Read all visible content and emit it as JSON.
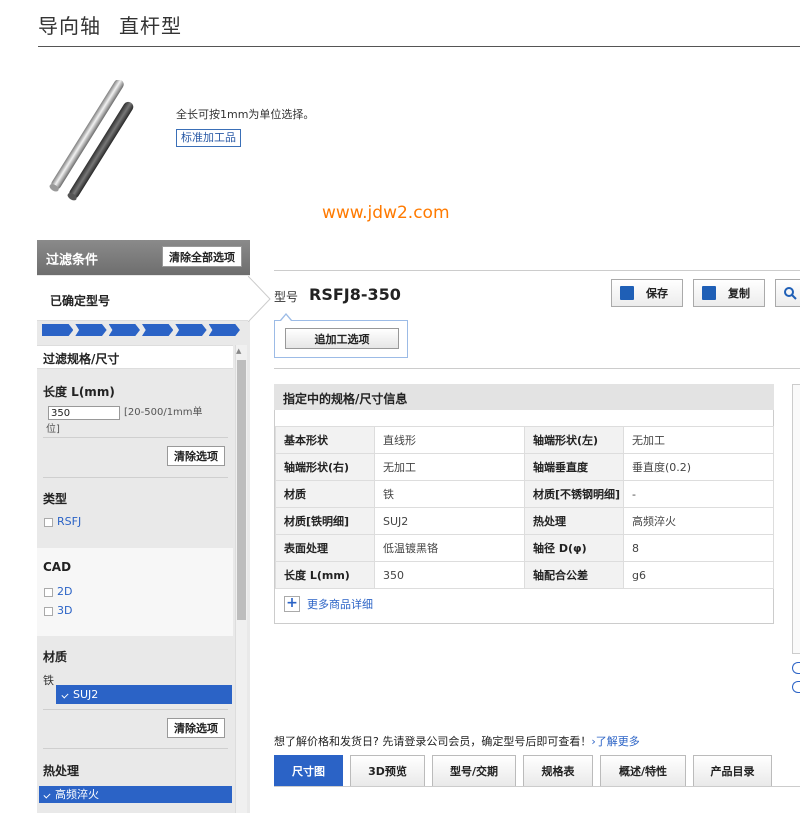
{
  "header": {
    "title_part1": "导向轴",
    "title_part2": "直杆型"
  },
  "product": {
    "description": "全长可按1mm为单位选择。",
    "tag": "标准加工品",
    "watermark": "www.jdw2.com"
  },
  "sidebar": {
    "filter_title": "过滤条件",
    "clear_all_label": "清除全部选项",
    "confirmed_label": "已确定型号",
    "step_count": 6,
    "spec_section_label": "过滤规格/尺寸",
    "length": {
      "title": "长度 L(mm)",
      "value": "350",
      "range_line1": "[20-500/1mm单",
      "range_line2": "位]",
      "clear_label": "清除选项"
    },
    "type": {
      "title": "类型",
      "options": [
        {
          "label": "RSFJ",
          "checked": false
        }
      ]
    },
    "cad": {
      "title": "CAD",
      "options": [
        {
          "label": "2D",
          "checked": false
        },
        {
          "label": "3D",
          "checked": false
        }
      ]
    },
    "material": {
      "title": "材质",
      "group": "铁",
      "options": [
        {
          "label": "SUJ2",
          "checked": true
        }
      ],
      "clear_label": "清除选项"
    },
    "heat": {
      "title": "热处理",
      "options": [
        {
          "label": "高频淬火",
          "checked": true
        }
      ]
    }
  },
  "main": {
    "model_label": "型号",
    "model_value": "RSFJ8-350",
    "actions": {
      "save_label": "保存",
      "copy_label": "复制"
    },
    "add_option_label": "追加工选项",
    "spec_title": "指定中的规格/尺寸信息",
    "specs": [
      [
        "基本形状",
        "直线形",
        "轴端形状(左)",
        "无加工"
      ],
      [
        "轴端形状(右)",
        "无加工",
        "轴端垂直度",
        "垂直度(0.2)"
      ],
      [
        "材质",
        "铁",
        "材质[不锈钢明细]",
        "-"
      ],
      [
        "材质[铁明细]",
        "SUJ2",
        "热处理",
        "高频淬火"
      ],
      [
        "表面处理",
        "低温镀黑铬",
        "轴径 D(φ)",
        "8"
      ],
      [
        "长度 L(mm)",
        "350",
        "轴配合公差",
        "g6"
      ]
    ],
    "more_label": "更多商品详细",
    "login_note": "想了解价格和发货日? 先请登录公司会员，确定型号后即可查看！",
    "login_link": "›了解更多",
    "tabs": [
      "尺寸图",
      "3D预览",
      "型号/交期",
      "规格表",
      "概述/特性",
      "产品目录"
    ],
    "active_tab": 0
  },
  "colors": {
    "accent": "#2b63c6",
    "watermark": "#ff7a00",
    "header_bg": "#7a7a7a"
  }
}
